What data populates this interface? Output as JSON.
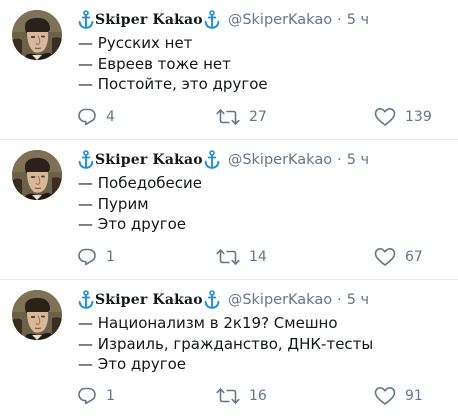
{
  "tweets": [
    {
      "display_name": "Skiper Kakao",
      "handle": "@SkiperKakao",
      "separator": "·",
      "time": "5 ч",
      "lines": [
        "— Русских нет",
        "— Евреев тоже нет",
        "— Постойте, это другое"
      ],
      "replies": "4",
      "retweets": "27",
      "likes": "139"
    },
    {
      "display_name": "Skiper Kakao",
      "handle": "@SkiperKakao",
      "separator": "·",
      "time": "5 ч",
      "lines": [
        "— Победобесие",
        "— Пурим",
        "— Это другое"
      ],
      "replies": "1",
      "retweets": "14",
      "likes": "67"
    },
    {
      "display_name": "Skiper Kakao",
      "handle": "@SkiperKakao",
      "separator": "·",
      "time": "5 ч",
      "lines": [
        "— Национализм в 2к19? Смешно",
        "— Израиль, гражданство, ДНК-тесты",
        "— Это другое"
      ],
      "replies": "1",
      "retweets": "16",
      "likes": "91"
    }
  ],
  "icons": {
    "name_decoration": "anchor-icon",
    "reply": "reply-icon",
    "retweet": "retweet-icon",
    "like": "heart-icon"
  },
  "colors": {
    "text": "#14171a",
    "secondary": "#657786",
    "anchor": "#1da1f2",
    "divider": "#e6ecf0"
  }
}
